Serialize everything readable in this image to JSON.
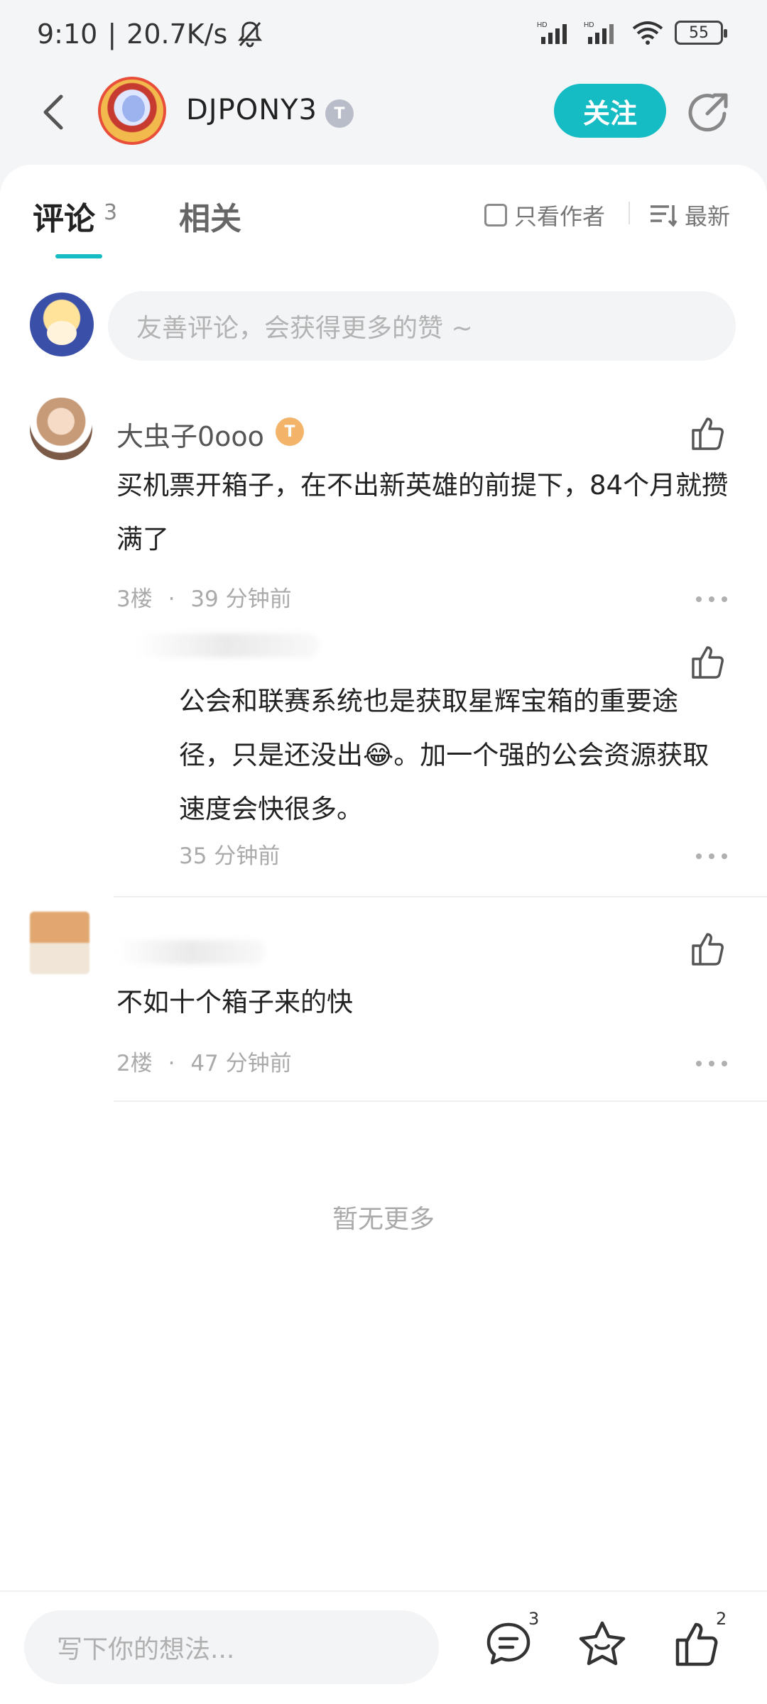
{
  "status_bar": {
    "time": "9:10",
    "speed": "20.7K/s",
    "battery": "55"
  },
  "header": {
    "author_name": "DJPONY3",
    "author_badge": "T",
    "follow_label": "关注"
  },
  "tabs": {
    "comments_label": "评论",
    "comments_count": "3",
    "related_label": "相关",
    "author_only_label": "只看作者",
    "sort_label": "最新"
  },
  "compose": {
    "placeholder": "友善评论，会获得更多的赞 ~"
  },
  "comments": [
    {
      "author": "大虫子0ooo",
      "badge": "T",
      "text": "买机票开箱子，在不出新英雄的前提下，84个月就攒满了",
      "floor": "3楼",
      "time": "39 分钟前",
      "reply": {
        "text": "公会和联赛系统也是获取星辉宝箱的重要途径，只是还没出😂。加一个强的公会资源获取速度会快很多。",
        "time": "35 分钟前"
      }
    },
    {
      "author": "",
      "text": "不如十个箱子来的快",
      "floor": "2楼",
      "time": "47 分钟前"
    }
  ],
  "meta_separator": "·",
  "no_more": "暂无更多",
  "bottom_bar": {
    "placeholder": "写下你的想法...",
    "comment_count": "3",
    "like_count": "2"
  },
  "colors": {
    "accent": "#16bcc4",
    "badge_gold": "#f3b46a",
    "badge_silver": "#b9bdc9"
  },
  "icons": [
    "back-arrow-icon",
    "share-icon",
    "checkbox-icon",
    "sort-icon",
    "thumbs-up-icon",
    "more-dots-icon",
    "comment-icon",
    "star-icon",
    "notification-off-icon",
    "signal-icon",
    "wifi-icon",
    "battery-icon"
  ]
}
